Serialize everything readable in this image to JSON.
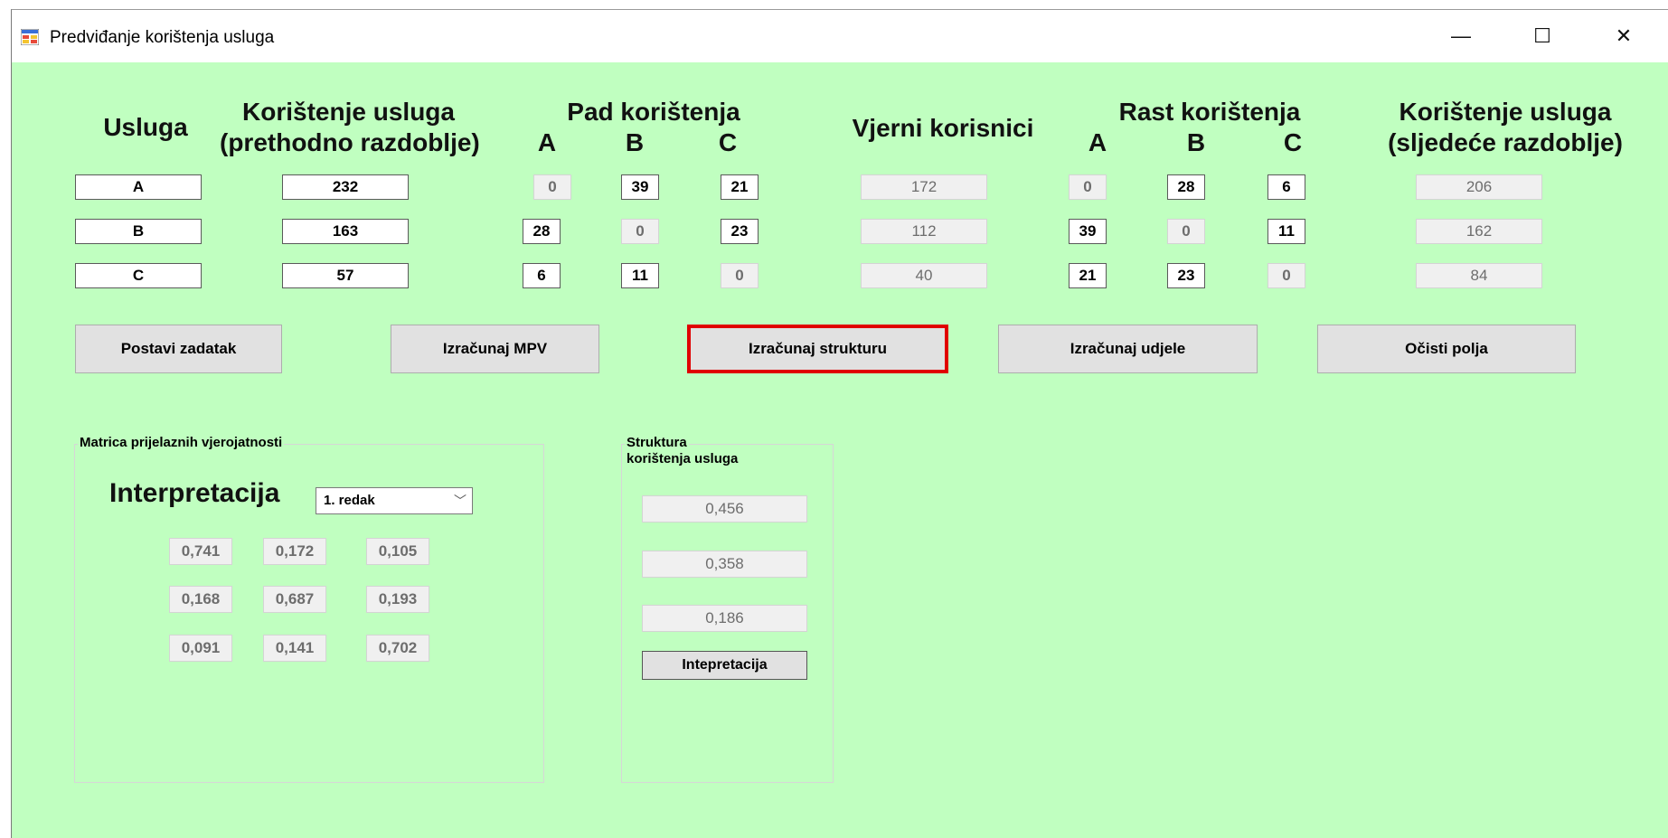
{
  "window": {
    "title": "Predviđanje korištenja usluga",
    "minimize": "—",
    "maximize": "☐",
    "close": "✕"
  },
  "headers": {
    "usluga": "Usluga",
    "koristenje_prev_1": "Korištenje usluga",
    "koristenje_prev_2": "(prethodno razdoblje)",
    "pad": "Pad korištenja",
    "pad_a": "A",
    "pad_b": "B",
    "pad_c": "C",
    "vjerni": "Vjerni korisnici",
    "rast": "Rast korištenja",
    "rast_a": "A",
    "rast_b": "B",
    "rast_c": "C",
    "koristenje_next_1": "Korištenje usluga",
    "koristenje_next_2": "(sljedeće razdoblje)"
  },
  "rows": [
    {
      "usluga": "A",
      "prev": "232",
      "pad_a": "0",
      "pad_b": "39",
      "pad_c": "21",
      "vjerni": "172",
      "rast_a": "0",
      "rast_b": "28",
      "rast_c": "6",
      "next": "206"
    },
    {
      "usluga": "B",
      "prev": "163",
      "pad_a": "28",
      "pad_b": "0",
      "pad_c": "23",
      "vjerni": "112",
      "rast_a": "39",
      "rast_b": "0",
      "rast_c": "11",
      "next": "162"
    },
    {
      "usluga": "C",
      "prev": "57",
      "pad_a": "6",
      "pad_b": "11",
      "pad_c": "0",
      "vjerni": "40",
      "rast_a": "21",
      "rast_b": "23",
      "rast_c": "0",
      "next": "84"
    }
  ],
  "buttons": {
    "postavi": "Postavi zadatak",
    "mpv": "Izračunaj MPV",
    "struktura": "Izračunaj strukturu",
    "udjele": "Izračunaj udjele",
    "ocisti": "Očisti polja"
  },
  "matrix_group": {
    "label": "Matrica prijelaznih vjerojatnosti",
    "interpretacija": "Interpretacija",
    "combo_value": "1. redak",
    "values": [
      [
        "0,741",
        "0,172",
        "0,105"
      ],
      [
        "0,168",
        "0,687",
        "0,193"
      ],
      [
        "0,091",
        "0,141",
        "0,702"
      ]
    ]
  },
  "structure_group": {
    "label_1": "Struktura",
    "label_2": "korištenja usluga",
    "values": [
      "0,456",
      "0,358",
      "0,186"
    ],
    "button": "Intepretacija"
  },
  "colors": {
    "form_bg": "#c0ffc0",
    "focus_border": "#e00000"
  }
}
